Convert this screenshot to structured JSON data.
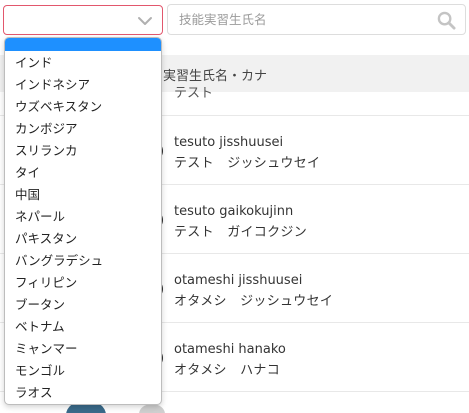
{
  "filters": {
    "country_select_value": "",
    "search_placeholder": "技能実習生氏名"
  },
  "list": {
    "header_label": "実習生氏名・カナ",
    "partial_row_text": "テスト",
    "rows": [
      {
        "romaji": "tesuto jisshuusei",
        "kana": "テスト　ジッシュウセイ"
      },
      {
        "romaji": "tesuto gaikokujinn",
        "kana": "テスト　ガイコクジン"
      },
      {
        "romaji": "otameshi jisshuusei",
        "kana": "オタメシ　ジッシュウセイ"
      },
      {
        "romaji": "otameshi hanako",
        "kana": "オタメシ　ハナコ"
      }
    ]
  },
  "dropdown": {
    "selected_index": 0,
    "options": [
      "",
      "インド",
      "インドネシア",
      "ウズベキスタン",
      "カンボジア",
      "スリランカ",
      "タイ",
      "中国",
      "ネパール",
      "パキスタン",
      "バングラデシュ",
      "フィリピン",
      "ブータン",
      "ベトナム",
      "ミャンマー",
      "モンゴル",
      "ラオス"
    ]
  },
  "colors": {
    "select_border": "#e2576d",
    "option_highlight": "#1e90ff",
    "header_bg": "#f1f1f1"
  },
  "icons": {
    "select_chevron": "chevron-down-icon",
    "search": "search-icon"
  }
}
